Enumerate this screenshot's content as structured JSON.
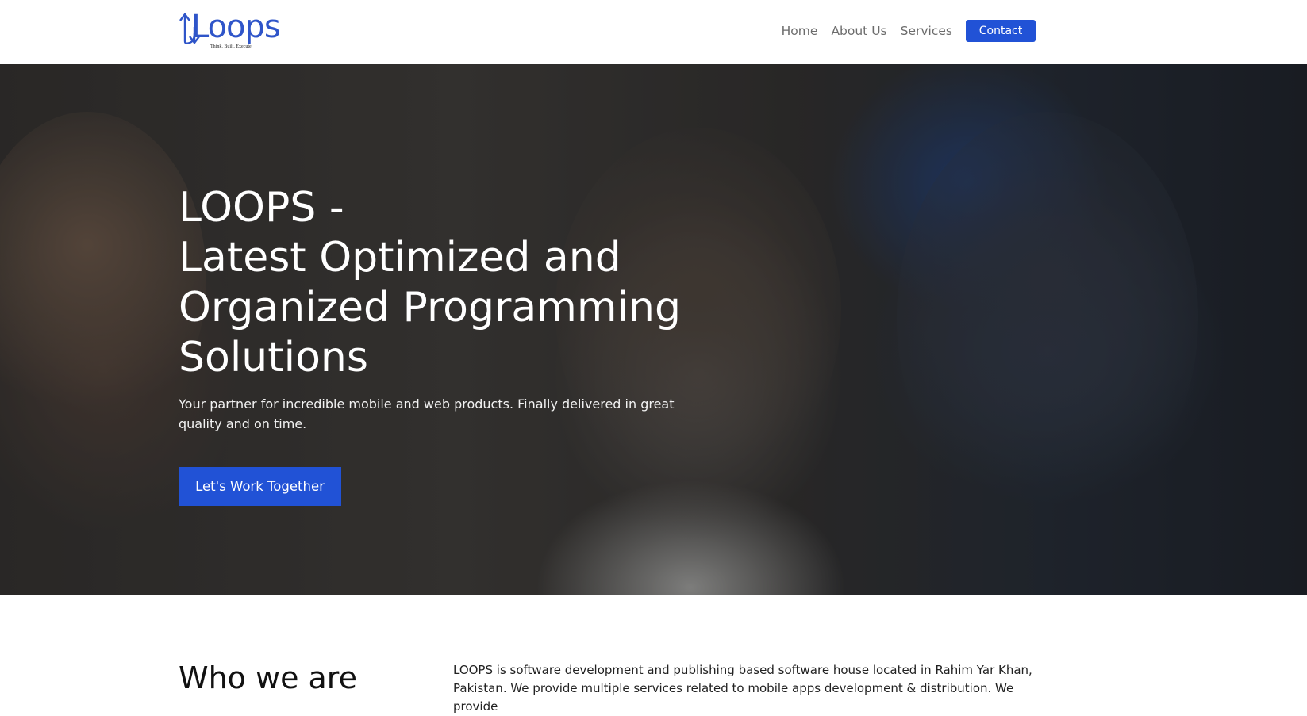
{
  "header": {
    "logo": {
      "text": "Loops",
      "tagline": "Think. Built. Execute."
    },
    "nav": {
      "home": "Home",
      "about": "About Us",
      "services": "Services",
      "contact": "Contact"
    }
  },
  "hero": {
    "title_lines": [
      "LOOPS -",
      "Latest Optimized and",
      "Organized Programming",
      "Solutions"
    ],
    "subtitle": "Your partner for incredible mobile and web products. Finally delivered in great quality and on time.",
    "cta_label": "Let's Work Together"
  },
  "about": {
    "title": "Who we are",
    "text": "LOOPS is software development and publishing based software house located in Rahim Yar Khan, Pakistan. We provide multiple services related to mobile apps development & distribution. We provide"
  },
  "colors": {
    "brand_blue": "#2152d6",
    "logo_blue": "#2f55c9"
  },
  "icons": {
    "logo": "loops-arrow-logo"
  }
}
